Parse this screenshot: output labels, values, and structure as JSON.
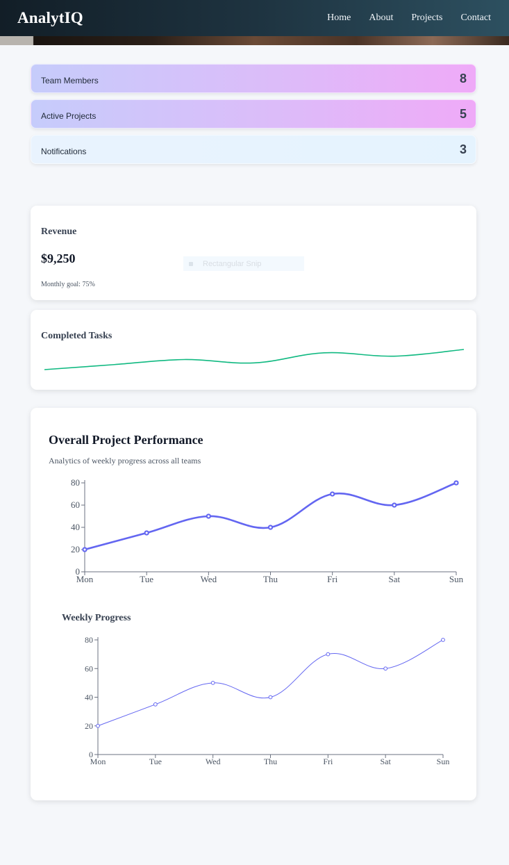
{
  "nav": {
    "brand": "AnalytIQ",
    "links": [
      "Home",
      "About",
      "Projects",
      "Contact"
    ]
  },
  "stats": [
    {
      "label": "Team Members",
      "value": "8"
    },
    {
      "label": "Active Projects",
      "value": "5"
    },
    {
      "label": "Notifications",
      "value": "3"
    }
  ],
  "revenue": {
    "title": "Revenue",
    "value": "$9,250",
    "goal": "Monthly goal: 75%"
  },
  "snip_overlay": {
    "label": "Rectangular Snip"
  },
  "completed": {
    "title": "Completed Tasks",
    "line_color": "#10b981"
  },
  "performance": {
    "title": "Overall Project Performance",
    "subtitle": "Analytics of weekly progress across all teams"
  },
  "weekly": {
    "title": "Weekly Progress"
  },
  "colors": {
    "accent": "#6366f1",
    "green": "#10b981"
  },
  "chart_data": [
    {
      "type": "line",
      "title": "Completed Tasks",
      "x": [
        "1",
        "2",
        "3",
        "4",
        "5",
        "6",
        "7"
      ],
      "series": [
        {
          "values": [
            20,
            35,
            50,
            40,
            70,
            60,
            80
          ]
        }
      ]
    },
    {
      "type": "line",
      "title": "Overall Project Performance",
      "categories": [
        "Mon",
        "Tue",
        "Wed",
        "Thu",
        "Fri",
        "Sat",
        "Sun"
      ],
      "series": [
        {
          "values": [
            20,
            35,
            50,
            40,
            70,
            60,
            80
          ]
        }
      ],
      "ylim": [
        0,
        80
      ],
      "yticks": [
        0,
        20,
        40,
        60,
        80
      ]
    },
    {
      "type": "line",
      "title": "Weekly Progress",
      "categories": [
        "Mon",
        "Tue",
        "Wed",
        "Thu",
        "Fri",
        "Sat",
        "Sun"
      ],
      "series": [
        {
          "values": [
            20,
            35,
            50,
            40,
            70,
            60,
            80
          ]
        }
      ],
      "ylim": [
        0,
        80
      ],
      "yticks": [
        0,
        20,
        40,
        60,
        80
      ]
    }
  ]
}
